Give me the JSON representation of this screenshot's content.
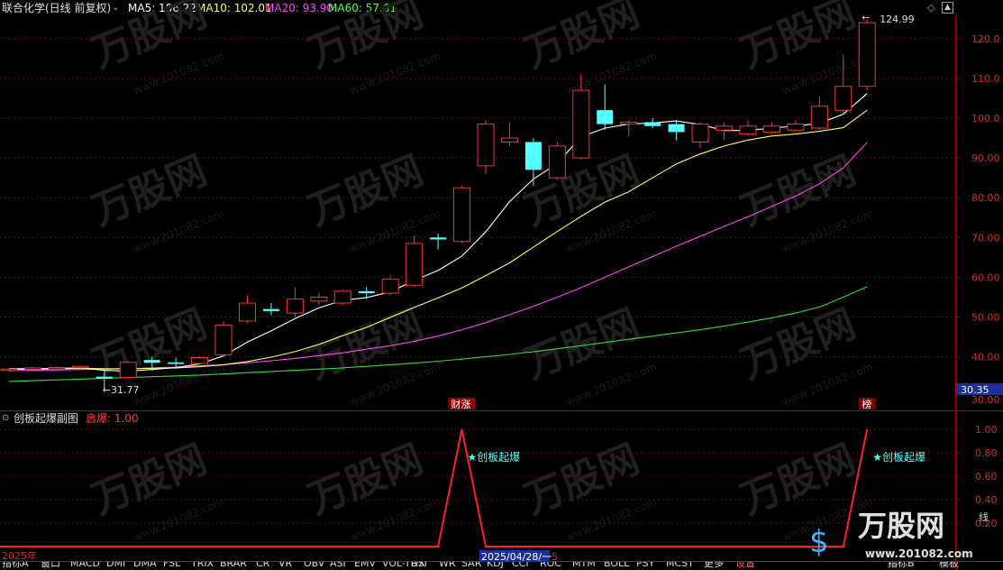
{
  "header": {
    "stock_title": "联合化学(日线 前复权)",
    "ma_lines": [
      {
        "label": "MA5: 106.22",
        "color": "#ffffff"
      },
      {
        "label": "MA10: 102.01",
        "color": "#ffff55"
      },
      {
        "label": "MA20: 93.90",
        "color": "#ff44ff"
      },
      {
        "label": "MA60: 57.61",
        "color": "#55ff55"
      }
    ]
  },
  "main_chart": {
    "y_ticks": [
      "120.0",
      "110.0",
      "100.0",
      "90.00",
      "80.00",
      "70.00",
      "60.00",
      "50.00",
      "40.00"
    ],
    "high_label": "124.99",
    "low_label": "31.77",
    "current_price": "30.35",
    "bottom_tick": "30.00",
    "event_tags": [
      "财涨",
      "榜"
    ]
  },
  "sub_chart": {
    "title": "创板起爆副图",
    "indicator": "启爆: 1.00",
    "y_ticks": [
      "1.00",
      "0.80",
      "0.60",
      "0.40",
      "0.20"
    ],
    "signal_labels": [
      "★创板起爆",
      "★创板起爆"
    ],
    "year_label": "2025年",
    "date_label": "2025/04/28/一",
    "date_suffix": "5"
  },
  "watermark": {
    "brand": "万股网",
    "url": "www.201082.com"
  },
  "tabs": [
    "指标A",
    "窗口",
    "MACD",
    "DMI",
    "DMA",
    "FSL",
    "TRIX",
    "BRAR",
    "CR",
    "VR",
    "OBV",
    "ASI",
    "EMV",
    "VOL-TDX",
    "RSI",
    "WR",
    "SAR",
    "KDJ",
    "CCI",
    "ROC",
    "MTM",
    "BOLL",
    "PSY",
    "MCST",
    "更多",
    "设置"
  ],
  "right_tabs": [
    "指标B",
    "模板"
  ],
  "right_edge_label": "线",
  "colors": {
    "up": "#ff3232",
    "down": "#54ffff",
    "grid": "#7a0000",
    "axis": "#b00000",
    "ma5": "#ffffff",
    "ma10": "#ffff55",
    "ma20": "#ff44ff",
    "ma60": "#33dd33",
    "signal": "#ff2020"
  },
  "chart_data": {
    "type": "candlestick",
    "ylim": [
      30,
      125
    ],
    "candles": [
      {
        "o": 36.6,
        "h": 37.0,
        "l": 36.2,
        "c": 36.9
      },
      {
        "o": 36.9,
        "h": 37.4,
        "l": 36.7,
        "c": 37.2
      },
      {
        "o": 37.2,
        "h": 37.6,
        "l": 36.9,
        "c": 37.3
      },
      {
        "o": 37.4,
        "h": 37.8,
        "l": 37.0,
        "c": 37.6
      },
      {
        "o": 35.0,
        "h": 36.5,
        "l": 31.77,
        "c": 34.5
      },
      {
        "o": 34.8,
        "h": 39.0,
        "l": 34.6,
        "c": 38.6
      },
      {
        "o": 39.2,
        "h": 40.0,
        "l": 36.5,
        "c": 38.5
      },
      {
        "o": 38.6,
        "h": 39.8,
        "l": 37.0,
        "c": 38.2
      },
      {
        "o": 38.3,
        "h": 40.2,
        "l": 38.0,
        "c": 39.8
      },
      {
        "o": 40.5,
        "h": 49.0,
        "l": 40.0,
        "c": 48.0
      },
      {
        "o": 49.0,
        "h": 55.5,
        "l": 48.5,
        "c": 53.5
      },
      {
        "o": 52.0,
        "h": 53.5,
        "l": 50.5,
        "c": 51.5
      },
      {
        "o": 51.0,
        "h": 57.5,
        "l": 50.0,
        "c": 54.5
      },
      {
        "o": 54.0,
        "h": 56.0,
        "l": 53.0,
        "c": 55.0
      },
      {
        "o": 53.5,
        "h": 57.0,
        "l": 53.0,
        "c": 56.5
      },
      {
        "o": 56.5,
        "h": 57.5,
        "l": 54.5,
        "c": 56.0
      },
      {
        "o": 56.0,
        "h": 60.5,
        "l": 55.5,
        "c": 59.5
      },
      {
        "o": 58.0,
        "h": 70.5,
        "l": 57.5,
        "c": 68.5
      },
      {
        "o": 70.0,
        "h": 71.0,
        "l": 67.0,
        "c": 69.5
      },
      {
        "o": 69.0,
        "h": 83.0,
        "l": 68.5,
        "c": 82.5
      },
      {
        "o": 88.0,
        "h": 99.5,
        "l": 86.0,
        "c": 98.5
      },
      {
        "o": 94.0,
        "h": 99.0,
        "l": 93.0,
        "c": 95.0
      },
      {
        "o": 94.0,
        "h": 95.0,
        "l": 83.0,
        "c": 87.0
      },
      {
        "o": 85.0,
        "h": 94.0,
        "l": 84.5,
        "c": 93.0
      },
      {
        "o": 90.0,
        "h": 111.0,
        "l": 89.5,
        "c": 107.0
      },
      {
        "o": 102.0,
        "h": 108.5,
        "l": 97.0,
        "c": 98.5
      },
      {
        "o": 98.5,
        "h": 99.5,
        "l": 95.5,
        "c": 99.0
      },
      {
        "o": 99.0,
        "h": 100.0,
        "l": 97.5,
        "c": 98.0
      },
      {
        "o": 98.5,
        "h": 99.5,
        "l": 94.5,
        "c": 96.5
      },
      {
        "o": 94.0,
        "h": 99.0,
        "l": 92.5,
        "c": 98.5
      },
      {
        "o": 97.0,
        "h": 99.0,
        "l": 94.5,
        "c": 98.0
      },
      {
        "o": 96.0,
        "h": 99.5,
        "l": 95.5,
        "c": 98.0
      },
      {
        "o": 96.5,
        "h": 99.0,
        "l": 96.0,
        "c": 98.0
      },
      {
        "o": 97.0,
        "h": 99.5,
        "l": 96.5,
        "c": 98.5
      },
      {
        "o": 97.5,
        "h": 105.5,
        "l": 97.0,
        "c": 103.0
      },
      {
        "o": 102.0,
        "h": 116.0,
        "l": 101.0,
        "c": 108.0
      },
      {
        "o": 108.0,
        "h": 124.99,
        "l": 107.0,
        "c": 124.0
      }
    ],
    "ma5": [
      37.0,
      37.0,
      37.1,
      37.2,
      36.6,
      36.4,
      36.8,
      37.3,
      38.2,
      40.2,
      43.7,
      46.5,
      49.6,
      52.3,
      54.2,
      54.9,
      56.3,
      59.2,
      61.7,
      65.3,
      71.4,
      79.0,
      84.7,
      88.6,
      95.3,
      97.5,
      98.5,
      98.8,
      99.3,
      98.4,
      96.9,
      96.9,
      97.5,
      98.0,
      98.7,
      101.0,
      106.2
    ],
    "ma10": [
      36.8,
      36.9,
      37.0,
      37.1,
      37.0,
      37.0,
      37.1,
      37.2,
      37.5,
      38.0,
      38.8,
      39.9,
      41.3,
      43.1,
      45.3,
      47.4,
      49.9,
      52.4,
      54.8,
      57.3,
      60.4,
      63.6,
      67.6,
      71.5,
      75.3,
      78.9,
      81.5,
      85.0,
      88.5,
      91.0,
      93.0,
      94.5,
      95.5,
      96.0,
      96.7,
      97.6,
      102.0
    ],
    "ma20": [
      36.5,
      36.6,
      36.7,
      36.8,
      36.9,
      37.0,
      37.2,
      37.4,
      37.7,
      38.0,
      38.5,
      39.0,
      39.6,
      40.3,
      41.0,
      41.9,
      42.8,
      43.9,
      45.2,
      46.8,
      48.6,
      50.6,
      52.7,
      55.0,
      57.4,
      60.0,
      62.6,
      65.2,
      67.8,
      70.3,
      72.8,
      75.2,
      77.8,
      80.4,
      83.5,
      87.5,
      93.9
    ],
    "ma60": [
      33.8,
      34.0,
      34.2,
      34.4,
      34.6,
      34.8,
      35.0,
      35.2,
      35.4,
      35.7,
      36.0,
      36.3,
      36.6,
      36.9,
      37.2,
      37.6,
      38.0,
      38.4,
      38.9,
      39.4,
      40.0,
      40.6,
      41.3,
      42.0,
      42.8,
      43.6,
      44.4,
      45.2,
      46.0,
      46.8,
      47.7,
      48.7,
      49.8,
      51.0,
      52.5,
      55.0,
      57.61
    ],
    "signal": [
      0,
      0,
      0,
      0,
      0,
      0,
      0,
      0,
      0,
      0,
      0,
      0,
      0,
      0,
      0,
      0,
      0,
      0,
      0,
      1,
      0,
      0,
      0,
      0,
      0,
      0,
      0,
      0,
      0,
      0,
      0,
      0,
      0,
      0,
      0,
      0,
      1
    ],
    "sub_ylim": [
      0,
      1.1
    ]
  }
}
